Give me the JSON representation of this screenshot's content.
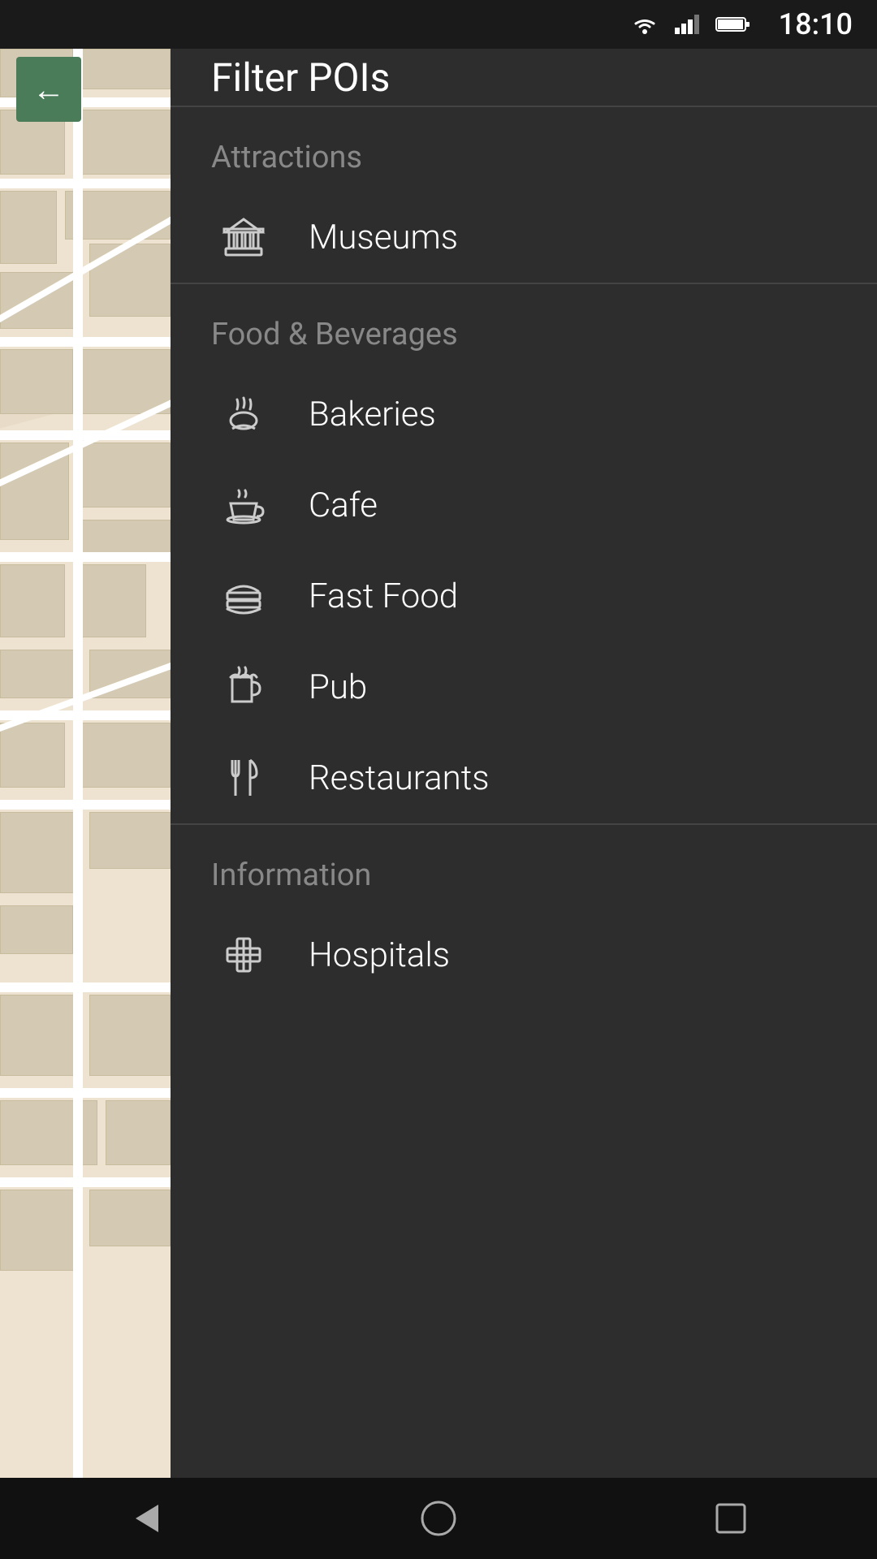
{
  "statusBar": {
    "time": "18:10"
  },
  "header": {
    "title": "Filter POIs",
    "backLabel": "←"
  },
  "sections": [
    {
      "id": "attractions",
      "label": "Attractions",
      "items": [
        {
          "id": "museums",
          "label": "Museums",
          "icon": "museum"
        }
      ]
    },
    {
      "id": "food-beverages",
      "label": "Food & Beverages",
      "items": [
        {
          "id": "bakeries",
          "label": "Bakeries",
          "icon": "bakery"
        },
        {
          "id": "cafe",
          "label": "Cafe",
          "icon": "cafe"
        },
        {
          "id": "fast-food",
          "label": "Fast Food",
          "icon": "fastfood"
        },
        {
          "id": "pub",
          "label": "Pub",
          "icon": "pub"
        },
        {
          "id": "restaurants",
          "label": "Restaurants",
          "icon": "restaurant"
        }
      ]
    },
    {
      "id": "information",
      "label": "Information",
      "items": [
        {
          "id": "hospitals",
          "label": "Hospitals",
          "icon": "hospital"
        }
      ]
    }
  ],
  "bottomNav": {
    "back": "◁",
    "home": "○",
    "recent": "□"
  }
}
